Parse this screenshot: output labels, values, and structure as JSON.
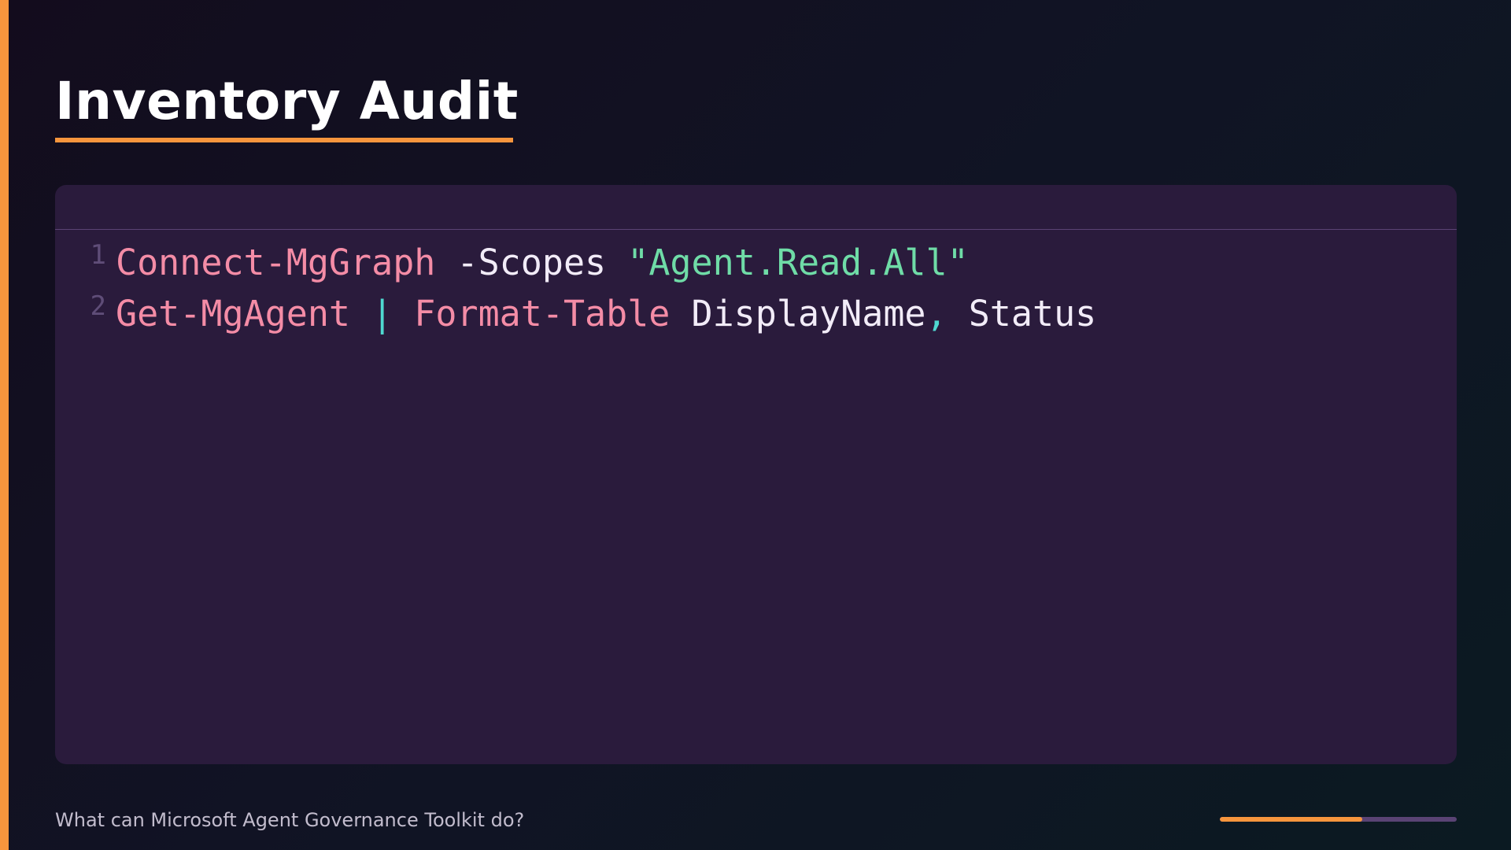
{
  "slide": {
    "title": "Inventory Audit",
    "footer": "What can Microsoft Agent Governance Toolkit do?",
    "progress": 0.6
  },
  "colors": {
    "accent": "#f7953d",
    "panel": "#2a1b3c",
    "cmdlet": "#f48ca6",
    "string": "#6fdca7",
    "operator": "#4fd8d0"
  },
  "code": {
    "lines": [
      {
        "number": "1",
        "tokens": [
          {
            "text": "Connect-MgGraph",
            "kind": "cmd"
          },
          {
            "text": " -Scopes ",
            "kind": "plain"
          },
          {
            "text": "\"Agent.Read.All\"",
            "kind": "str"
          }
        ]
      },
      {
        "number": "2",
        "tokens": [
          {
            "text": "Get-MgAgent",
            "kind": "cmd"
          },
          {
            "text": " ",
            "kind": "plain"
          },
          {
            "text": "|",
            "kind": "op"
          },
          {
            "text": " ",
            "kind": "plain"
          },
          {
            "text": "Format-Table",
            "kind": "cmd"
          },
          {
            "text": " DisplayName",
            "kind": "plain"
          },
          {
            "text": ",",
            "kind": "op"
          },
          {
            "text": " Status",
            "kind": "plain"
          }
        ]
      }
    ]
  }
}
